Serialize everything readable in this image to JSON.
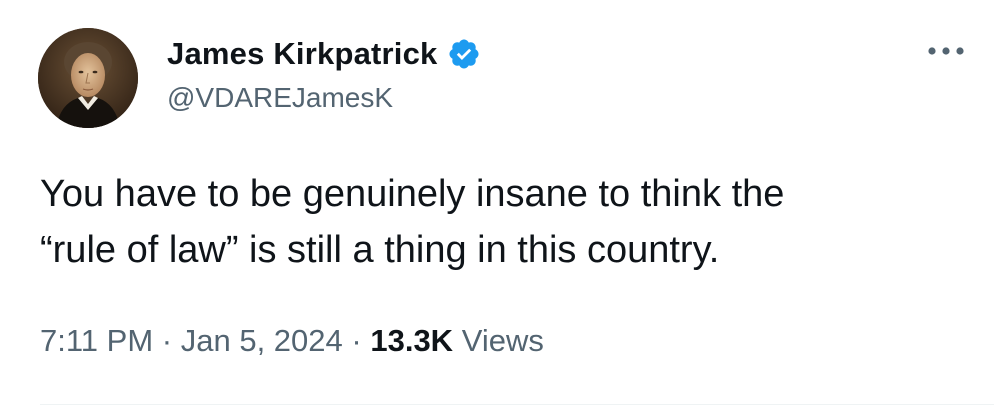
{
  "author": {
    "display_name": "James Kirkpatrick",
    "handle": "@VDAREJamesK",
    "verified": true,
    "verified_color": "#1d9bf0",
    "avatar": "portrait-avatar"
  },
  "tweet": {
    "text_line1": "You have to be genuinely insane to think the",
    "text_line2": "“rule of law” is still a thing in this country.",
    "time": "7:11 PM",
    "separator": "·",
    "date": "Jan 5, 2024",
    "views_count": "13.3K",
    "views_label": "Views"
  },
  "actions": {
    "more_icon": "more-horizontal-icon"
  },
  "colors": {
    "text": "#0f1419",
    "secondary": "#536471",
    "divider": "#eff3f4"
  }
}
